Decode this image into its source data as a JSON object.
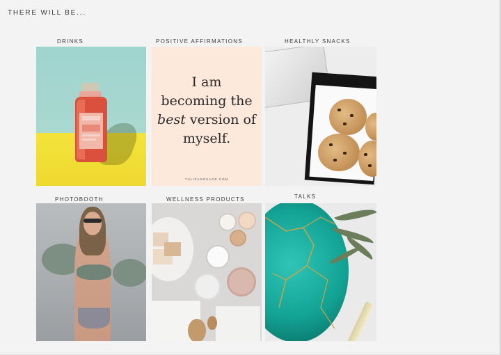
{
  "heading": "THERE WILL BE...",
  "tiles": [
    {
      "label": "DRINKS"
    },
    {
      "label": "POSITIVE AFFIRMATIONS"
    },
    {
      "label": "HEALTHLY SNACKS"
    },
    {
      "label": "PHOTOBOOTH"
    },
    {
      "label": "WELLNESS PRODUCTS"
    },
    {
      "label": "TALKS"
    }
  ],
  "affirmation": {
    "line1": "I am",
    "line2": "becoming the",
    "emphasis": "best",
    "line3_rest": " version of",
    "line4": "myself.",
    "credit": "TULIPANOSAGE.COM"
  },
  "colors": {
    "page_bg": "#f3f3f3",
    "drinks_wall": "#a9d8cf",
    "drinks_floor": "#f2e33a",
    "affirmation_bg": "#fde8dc",
    "talks_teal": "#13a394"
  }
}
